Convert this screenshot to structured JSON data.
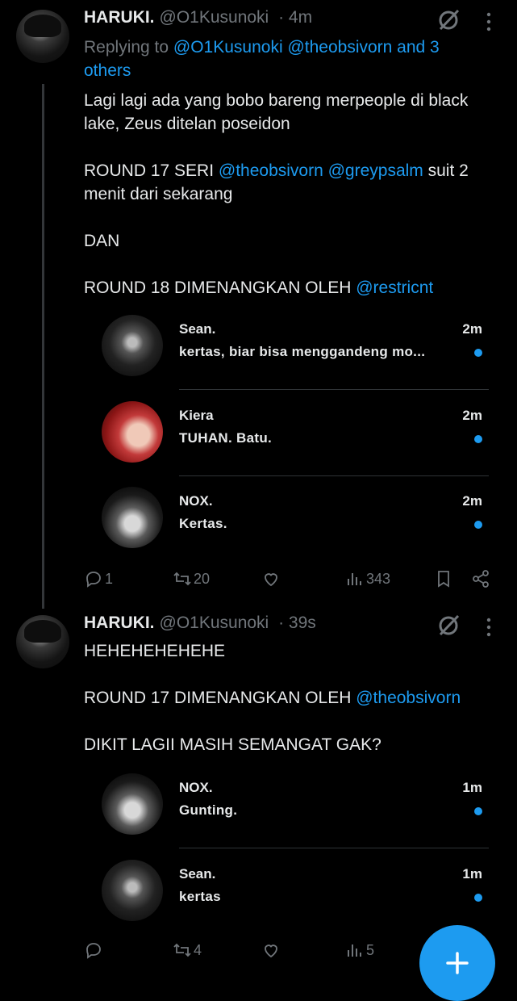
{
  "tweets": [
    {
      "author": "HARUKI.",
      "handle": "@O1Kusunoki",
      "time": "· 4m",
      "replying_prefix": "Replying to",
      "replying_to": "@O1Kusunoki @theobsivorn and 3 others",
      "paragraphs": [
        {
          "text": "Lagi lagi ada yang bobo bareng merpeople di black lake, Zeus ditelan poseidon"
        },
        {
          "text": "ROUND 17 SERI ",
          "link": "@theobsivorn @greypsalm",
          "after": " suit 2 menit dari sekarang"
        },
        {
          "text": "DAN"
        },
        {
          "text": "ROUND 18 DIMENANGKAN OLEH ",
          "link": "@restricnt"
        }
      ],
      "quotes": [
        {
          "name": "Sean.",
          "message": "kertas, biar bisa menggandeng mo...",
          "time": "2m"
        },
        {
          "name": "Kiera",
          "message": "TUHAN. Batu.",
          "time": "2m"
        },
        {
          "name": "NOX.",
          "message": "Kertas.",
          "time": "2m"
        }
      ],
      "actions": {
        "replies": "1",
        "reposts": "20",
        "likes": "",
        "views": "343"
      }
    },
    {
      "author": "HARUKI.",
      "handle": "@O1Kusunoki",
      "time": "· 39s",
      "paragraphs": [
        {
          "text": "HEHEHEHEHEHE"
        },
        {
          "text": "ROUND 17 DIMENANGKAN OLEH ",
          "link": "@theobsivorn"
        },
        {
          "text": "DIKIT LAGII MASIH SEMANGAT GAK?"
        }
      ],
      "quotes": [
        {
          "name": "NOX.",
          "message": "Gunting.",
          "time": "1m"
        },
        {
          "name": "Sean.",
          "message": "kertas",
          "time": "1m"
        }
      ],
      "actions": {
        "replies": "",
        "reposts": "4",
        "likes": "",
        "views": "5"
      }
    }
  ],
  "icons": {
    "reply": "reply-icon",
    "repost": "repost-icon",
    "like": "heart-icon",
    "views": "views-icon",
    "bookmark": "bookmark-icon",
    "share": "share-icon",
    "grok": "grok-icon",
    "more": "more-icon",
    "compose": "plus-icon"
  },
  "colors": {
    "accent": "#1d9bf0",
    "background": "#000000",
    "muted": "#71767b",
    "text": "#e7e9ea"
  }
}
